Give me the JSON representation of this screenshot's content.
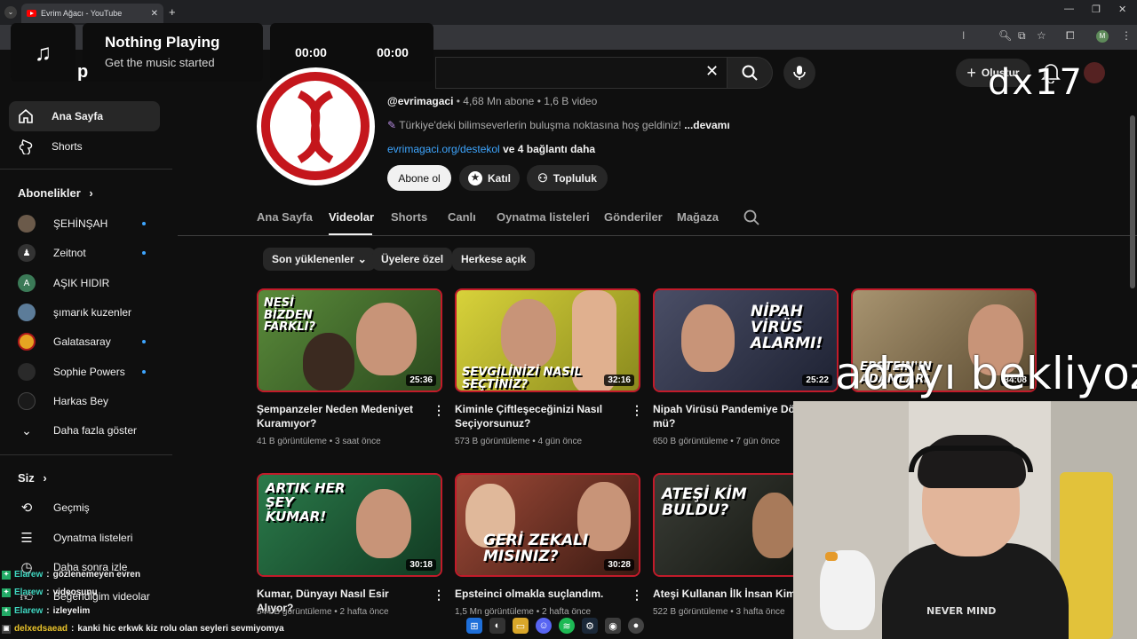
{
  "browser": {
    "tab_title": "Evrim Ağacı - YouTube",
    "new_tab": "+",
    "profile_initial": "M"
  },
  "music": {
    "title": "Nothing Playing",
    "subtitle": "Get the music started",
    "time_current": "00:00",
    "time_total": "00:00",
    "icon": "music-note-icon"
  },
  "header": {
    "create_label": "Oluştur",
    "clear_icon": "✕",
    "overlay_name": "dx17"
  },
  "sidebar": {
    "main": [
      {
        "label": "Ana Sayfa",
        "icon": "home-icon"
      },
      {
        "label": "Shorts",
        "icon": "shorts-icon"
      }
    ],
    "subs_title": "Abonelikler",
    "subs": [
      {
        "label": "ŞEHİNŞAH",
        "color": "#6b5a4a",
        "dot": true
      },
      {
        "label": "Zeitnot",
        "color": "#333333",
        "dot": true
      },
      {
        "label": "AŞIK HIDIR",
        "initial": "A",
        "color": "#3b7a57",
        "dot": false
      },
      {
        "label": "şımarık kuzenler",
        "color": "#5c7c99",
        "dot": false
      },
      {
        "label": "Galatasaray",
        "color": "#e6a422",
        "dot": true
      },
      {
        "label": "Sophie Powers",
        "color": "#2a2a2a",
        "dot": true
      },
      {
        "label": "Harkas Bey",
        "color": "#1a1a1a",
        "dot": false
      }
    ],
    "show_more": "Daha fazla göster",
    "you_title": "Siz",
    "you": [
      {
        "label": "Geçmiş",
        "icon": "history-icon"
      },
      {
        "label": "Oynatma listeleri",
        "icon": "playlist-icon"
      },
      {
        "label": "Daha sonra izle",
        "icon": "watch-later-icon"
      },
      {
        "label": "Beğendiğim videolar",
        "icon": "like-icon"
      }
    ]
  },
  "channel": {
    "handle": "@evrimagaci",
    "subs": " • 4,68 Mn abone • 1,6 B video",
    "desc": "Türkiye'deki bilimseverlerin buluşma noktasına hoş geldiniz!",
    "more": " ...devamı",
    "link": "evrimagaci.org/destekol",
    "link_more": " ve 4 bağlantı daha",
    "subscribe": "Abone ol",
    "join": "Katıl",
    "community": "Topluluk"
  },
  "tabs": [
    "Ana Sayfa",
    "Videolar",
    "Shorts",
    "Canlı",
    "Oynatma listeleri",
    "Gönderiler",
    "Mağaza"
  ],
  "chips": [
    "Son yüklenenler",
    "Üyelere özel",
    "Herkese açık"
  ],
  "videos": [
    {
      "thumb_text": "NESİ BİZDEN FARKLI?",
      "duration": "25:36",
      "title": "Şempanzeler Neden Medeniyet Kuramıyor?",
      "meta": "41 B görüntüleme • 3 saat önce",
      "bg": "#3f6b2a"
    },
    {
      "thumb_text": "SEVGİLİNİZİ NASIL SEÇTİNİZ?",
      "duration": "32:16",
      "title": "Kiminle Çiftleşeceğinizi Nasıl Seçiyorsunuz?",
      "meta": "573 B görüntüleme • 4 gün önce",
      "bg": "#b9b82a"
    },
    {
      "thumb_text": "NİPAH VİRÜS ALARMI!",
      "duration": "25:22",
      "title": "Nipah Virüsü Pandemiye Dönü mü?",
      "meta": "650 B görüntüleme • 7 gün önce",
      "bg": "#3b3f52"
    },
    {
      "thumb_text": "EPSTEIN'IN ADAMLARI",
      "duration": "34:08",
      "title": "",
      "meta": "",
      "bg": "#8b7a5a"
    },
    {
      "thumb_text": "ARTIK HER ŞEY KUMAR!",
      "duration": "30:18",
      "title": "Kumar, Dünyayı Nasıl Esir Alıyor?",
      "meta": "544 B görüntüleme • 2 hafta önce",
      "bg": "#1f5a3a"
    },
    {
      "thumb_text": "GERİ ZEKALI MISINIZ?",
      "duration": "30:28",
      "title": "Epsteinci olmakla suçlandım.",
      "meta": "1,5 Mn görüntüleme • 2 hafta önce",
      "bg": "#8a3a2a"
    },
    {
      "thumb_text": "ATEŞİ KİM BULDU?",
      "duration": "",
      "title": "Ateşi Kullanan İlk İnsan Kimdi?",
      "meta": "522 B görüntüleme • 3 hafta önce",
      "bg": "#2a2d2a"
    }
  ],
  "overlay_caption": "adayı bekliyoz",
  "chat": [
    {
      "name": "Elarew",
      "msg": "gözlenemeyen evren"
    },
    {
      "name": "Elarew",
      "msg": "videosunu"
    },
    {
      "name": "Elarew",
      "msg": "izleyelim"
    },
    {
      "name": "delxedsaead",
      "msg": "kanki hic erkwk kiz rolu olan seyleri sevmiyomya"
    }
  ]
}
